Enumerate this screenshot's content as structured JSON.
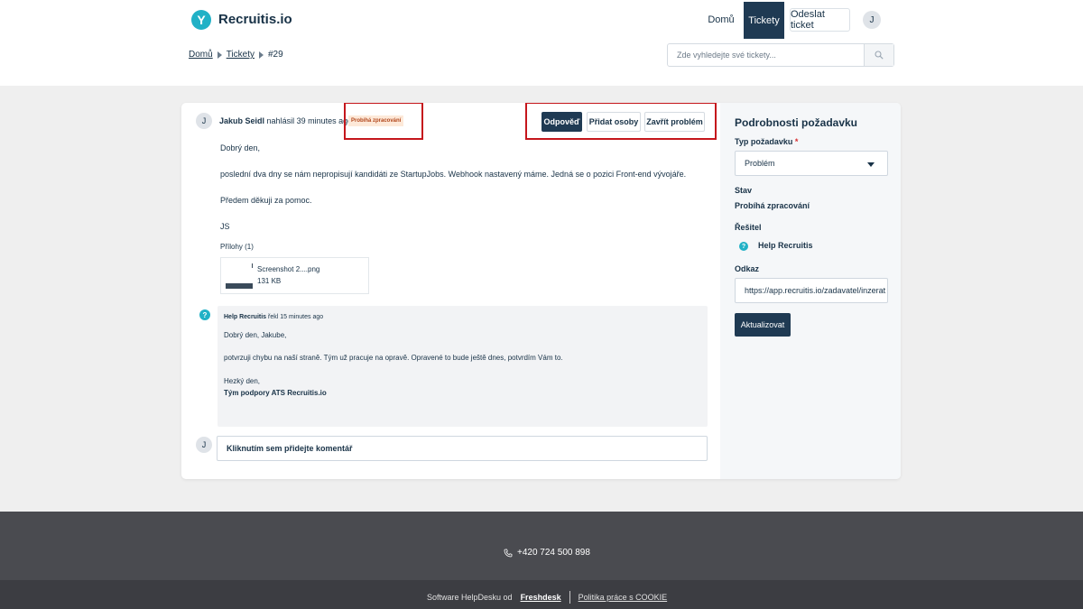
{
  "header": {
    "brand": "Recruitis.io",
    "nav": {
      "home": "Domů",
      "tickets": "Tickety",
      "send_ticket": "Odeslat ticket"
    },
    "user_initial": "J"
  },
  "breadcrumb": {
    "home": "Domů",
    "tickets": "Tickety",
    "current": "#29"
  },
  "search": {
    "placeholder": "Zde vyhledejte své tickety..."
  },
  "ticket": {
    "avatar": "J",
    "reporter": "Jakub Seidl",
    "action": "nahlásil",
    "time": "39 minutes ago",
    "status_badge": "Probíhá zpracování",
    "buttons": {
      "reply": "Odpověď",
      "add_people": "Přidat osoby",
      "close": "Zavřít problém"
    },
    "message": [
      "Dobrý den,",
      "poslední dva dny se nám nepropisují kandidáti ze StartupJobs. Webhook nastavený máme. Jedná se o pozici Front-end vývojáře.",
      "Předem děkuji za pomoc.",
      "JS"
    ],
    "attachments_label": "Přílohy (1)",
    "attachment": {
      "name": "Screenshot 2....png",
      "size": "131 KB"
    }
  },
  "reply": {
    "author": "Help Recruitis",
    "action": "řekl",
    "time": "15 minutes ago",
    "lines": [
      "Dobrý den, Jakube,",
      "potvrzuji chybu na naší straně. Tým už pracuje na opravě. Opravené to bude ještě dnes, potvrdím Vám to.",
      "Hezký den,",
      "Tým podpory ATS Recruitis.io"
    ]
  },
  "comment": {
    "avatar": "J",
    "placeholder": "Kliknutím sem přidejte komentář"
  },
  "sidebar": {
    "title": "Podrobnosti požadavku",
    "type_label": "Typ požadavku",
    "required_mark": "*",
    "type_value": "Problém",
    "status_label": "Stav",
    "status_value": "Probíhá zpracování",
    "agent_label": "Řešitel",
    "agent_value": "Help Recruitis",
    "link_label": "Odkaz",
    "link_value": "https://app.recruitis.io/zadavatel/inzerat",
    "update_button": "Aktualizovat"
  },
  "footer": {
    "phone": "+420 724 500 898",
    "software_text": "Software HelpDesku od",
    "freshdesk": "Freshdesk",
    "policy": "Politika práce s COOKIE"
  },
  "colors": {
    "primary": "#1f3a53",
    "accent": "#21b1c6",
    "highlight": "#c5161c",
    "status_bg": "#fde9d9"
  }
}
